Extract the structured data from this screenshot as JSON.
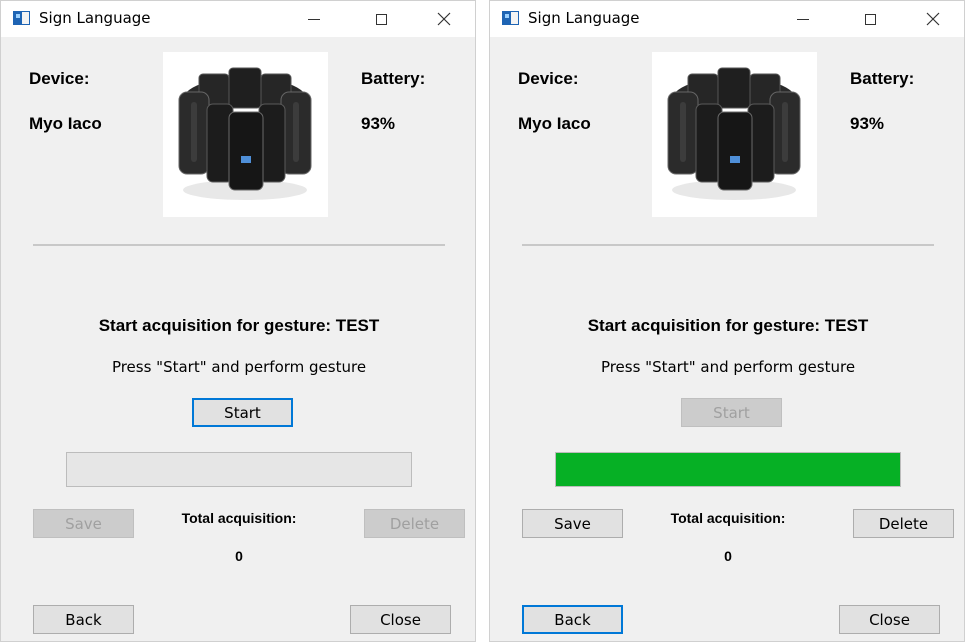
{
  "windows": [
    {
      "title": "Sign Language",
      "device_label": "Device:",
      "device_name": "Myo Iaco",
      "battery_label": "Battery:",
      "battery_value": "93%",
      "gesture_title": "Start acquisition for gesture: TEST",
      "instruction": "Press \"Start\" and perform gesture",
      "start_label": "Start",
      "start_state": "focused",
      "progress": 0,
      "save_label": "Save",
      "save_state": "disabled",
      "total_label": "Total acquisition:",
      "total_value": "0",
      "delete_label": "Delete",
      "delete_state": "disabled",
      "back_label": "Back",
      "back_state": "normal",
      "close_label": "Close",
      "close_state": "normal"
    },
    {
      "title": "Sign Language",
      "device_label": "Device:",
      "device_name": "Myo Iaco",
      "battery_label": "Battery:",
      "battery_value": "93%",
      "gesture_title": "Start acquisition for gesture: TEST",
      "instruction": "Press \"Start\" and perform gesture",
      "start_label": "Start",
      "start_state": "disabled",
      "progress": 100,
      "save_label": "Save",
      "save_state": "normal",
      "total_label": "Total acquisition:",
      "total_value": "0",
      "delete_label": "Delete",
      "delete_state": "normal",
      "back_label": "Back",
      "back_state": "focused",
      "close_label": "Close",
      "close_state": "normal"
    }
  ],
  "colors": {
    "progress_fill": "#06b025",
    "focus_border": "#0078d7",
    "window_bg": "#f0f0f0"
  },
  "icons": {
    "app": "app-window-icon",
    "minimize": "minimize-icon",
    "maximize": "maximize-icon",
    "close": "close-icon",
    "device": "myo-armband-image"
  }
}
